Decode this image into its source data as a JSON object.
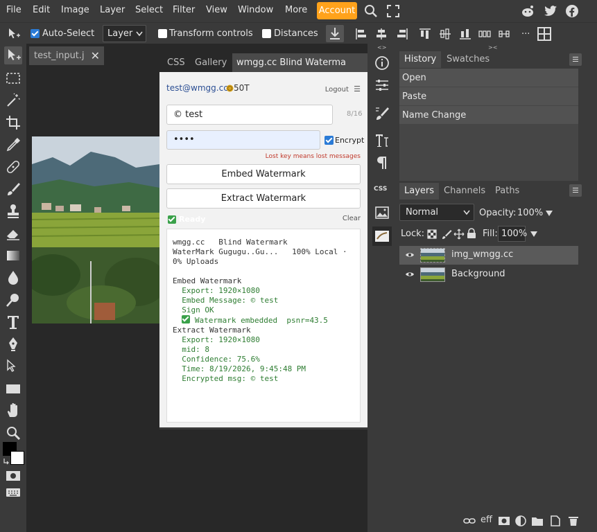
{
  "menubar": {
    "items": [
      "File",
      "Edit",
      "Image",
      "Layer",
      "Select",
      "Filter",
      "View",
      "Window",
      "More"
    ],
    "account": "Account",
    "icons": [
      "search-icon",
      "fullscreen-icon",
      "reddit-icon",
      "twitter-icon",
      "facebook-icon"
    ],
    "accent": "#ffa21b"
  },
  "optbar": {
    "auto_select": "Auto-Select",
    "layer_mode": "Layer",
    "transform_controls": "Transform controls",
    "distances": "Distances",
    "more": "..."
  },
  "document": {
    "tab_title": "test_input.j"
  },
  "plugin": {
    "tabs": [
      "CSS",
      "Gallery",
      "wmgg.cc Blind Waterma"
    ],
    "email": "test@wmgg.cc",
    "coins": "50T",
    "logout": "Logout",
    "message_value": "© test",
    "message_count": "8/16",
    "password_value": "••••",
    "encrypt_label": "Encrypt",
    "warning": "Lost key means lost messages",
    "embed_button": "Embed Watermark",
    "extract_button": "Extract Watermark",
    "status": "Ready",
    "clear": "Clear",
    "log": {
      "header1": "wmgg.cc   Blind Watermark",
      "header2": "WaterMark Gugugu..Gu...   100% Local ·",
      "header3": "0% Uploads",
      "embed_title": "Embed Watermark",
      "embed_export": "  Export: 1920×1080",
      "embed_message": "  Embed Message: © test",
      "sign_ok": "  Sign OK",
      "embedded": "Watermark embedded  psnr=43.5",
      "extract_title": "Extract Watermark",
      "extract_export": "  Export: 1920×1080",
      "mid": "  mid: 8",
      "confidence": "  Confidence: 75.6%",
      "time": "  Time: 8/19/2026, 9:45:48 PM",
      "encrypted_msg": "  Encrypted msg: © test"
    }
  },
  "history": {
    "tabs": [
      "History",
      "Swatches"
    ],
    "items": [
      "Open",
      "Paste",
      "Name Change"
    ]
  },
  "layers": {
    "tabs": [
      "Layers",
      "Channels",
      "Paths"
    ],
    "blend_mode": "Normal",
    "opacity_label": "Opacity:",
    "opacity_value": "100%",
    "lock_label": "Lock:",
    "fill_label": "Fill:",
    "fill_value": "100%",
    "rows": [
      {
        "name": "img_wmgg.cc",
        "selected": true
      },
      {
        "name": "Background",
        "selected": false
      }
    ],
    "footer_text": "eff"
  },
  "strip": {
    "css_label": "CSS"
  }
}
